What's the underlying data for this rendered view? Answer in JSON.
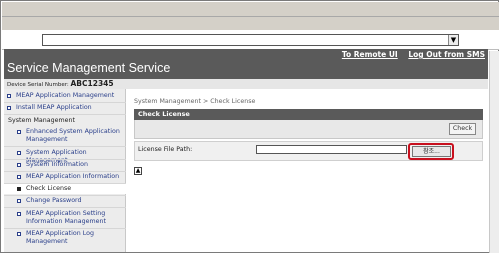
{
  "browser": {
    "address_dropdown_glyph": "▼"
  },
  "header": {
    "title": "Service Management Service",
    "links": [
      "To Remote UI",
      "Log Out from SMS"
    ],
    "serial_label": "Device Serial Number:",
    "serial_value": "ABC12345"
  },
  "sidebar": {
    "items": [
      {
        "label": "MEAP Application Management",
        "level": "top"
      },
      {
        "label": "Install MEAP Application",
        "level": "top"
      },
      {
        "label": "System Management",
        "level": "section"
      },
      {
        "label": "Enhanced System Application Management",
        "level": "sub"
      },
      {
        "label": "System Application Management",
        "level": "sub"
      },
      {
        "label": "System Information",
        "level": "sub"
      },
      {
        "label": "MEAP Application Information",
        "level": "sub"
      },
      {
        "label": "Check License",
        "level": "sub",
        "active": true
      },
      {
        "label": "Change Password",
        "level": "sub"
      },
      {
        "label": "MEAP Application Setting Information Management",
        "level": "sub"
      },
      {
        "label": "MEAP Application Log Management",
        "level": "sub"
      }
    ]
  },
  "main": {
    "breadcrumb": "System Management > Check License",
    "panel_title": "Check License",
    "check_button": "Check",
    "file_label": "License File Path:",
    "file_value": "",
    "browse_button": "참조...",
    "scroll_glyph": "▲"
  },
  "colors": {
    "header_bg": "#5a5a5a",
    "link": "#2a3f8a",
    "highlight": "#c8101e"
  }
}
